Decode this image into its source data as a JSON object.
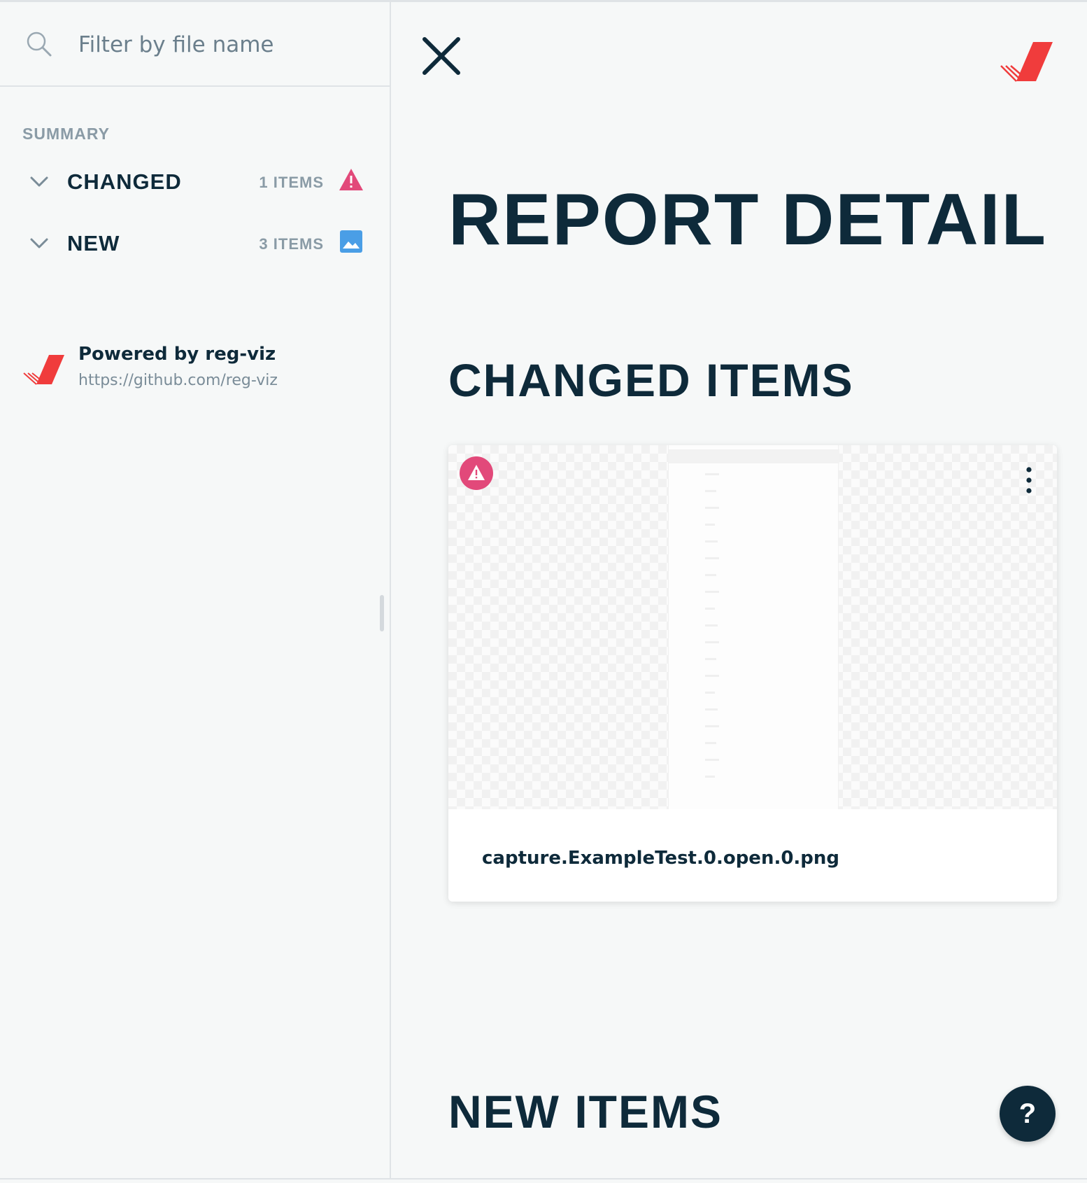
{
  "search": {
    "placeholder": "Filter by file name",
    "value": ""
  },
  "sidebar": {
    "summary_title": "SUMMARY",
    "items": [
      {
        "label": "CHANGED",
        "count": "1 ITEMS",
        "icon": "warning-icon"
      },
      {
        "label": "NEW",
        "count": "3 ITEMS",
        "icon": "image-icon"
      }
    ],
    "powered": {
      "title": "Powered by reg-viz",
      "link": "https://github.com/reg-viz"
    }
  },
  "main": {
    "title": "REPORT DETAIL",
    "changed_section": "CHANGED ITEMS",
    "new_section": "NEW ITEMS",
    "cards": [
      {
        "caption": "capture.ExampleTest.0.open.0.png",
        "status_icon": "warning-icon"
      }
    ],
    "help_label": "?"
  },
  "colors": {
    "text_dark": "#0e2a3a",
    "muted": "#8a9ba6",
    "warning": "#e2497a",
    "new_blue": "#4a9ee6",
    "brand_red": "#f03c3c",
    "background": "#f6f8f8"
  }
}
